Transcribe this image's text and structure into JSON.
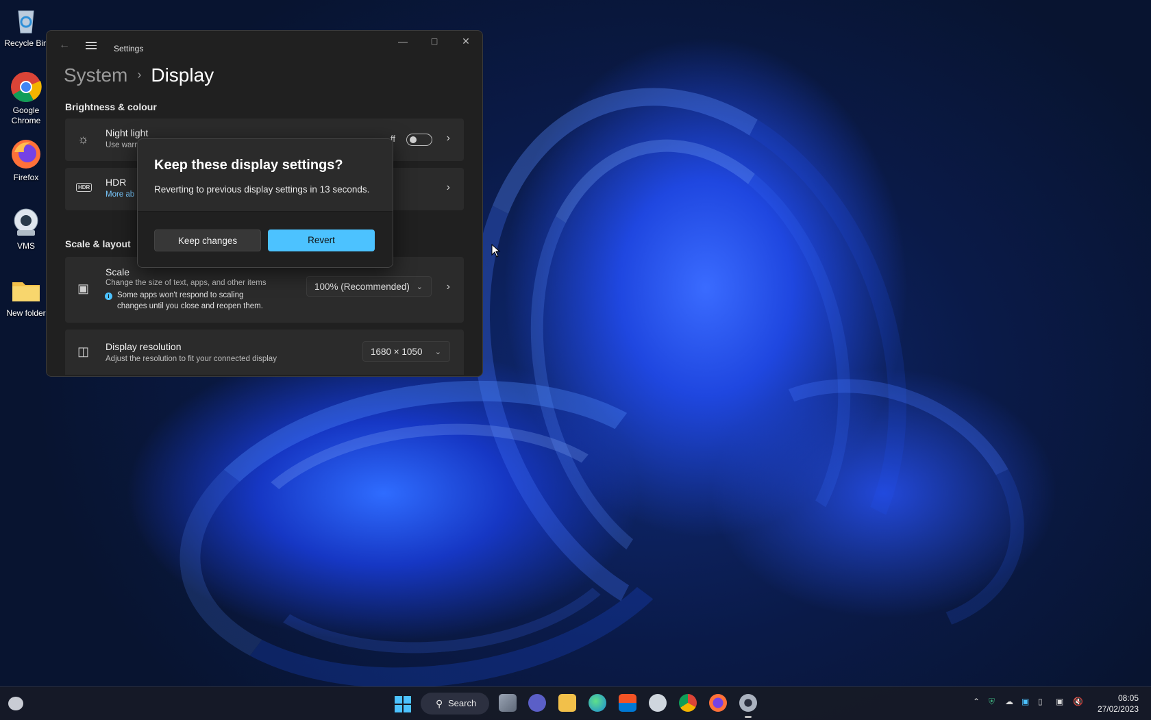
{
  "desktop": {
    "icons": [
      {
        "label": "Recycle Bin"
      },
      {
        "label": "Google Chrome"
      },
      {
        "label": "Firefox"
      },
      {
        "label": "VMS"
      },
      {
        "label": "New folder"
      }
    ]
  },
  "settings": {
    "title": "Settings",
    "breadcrumb": {
      "parent": "System",
      "separator": "›",
      "current": "Display"
    },
    "brightness_section": "Brightness & colour",
    "night_light": {
      "label": "Night light",
      "desc": "Use warm",
      "state": "ff"
    },
    "hdr": {
      "label": "HDR",
      "link": "More ab"
    },
    "scale_section": "Scale & layout",
    "scale": {
      "label": "Scale",
      "desc": "Change the size of text, apps, and other items",
      "note_line1": "Some apps won't respond to scaling",
      "note_line2": "changes until you close and reopen them.",
      "value": "100% (Recommended)"
    },
    "resolution": {
      "label": "Display resolution",
      "desc": "Adjust the resolution to fit your connected display",
      "value": "1680 × 1050"
    }
  },
  "dialog": {
    "title": "Keep these display settings?",
    "message": "Reverting to previous display settings in 13 seconds.",
    "keep_label": "Keep changes",
    "revert_label": "Revert",
    "accent": "#4cc2ff"
  },
  "taskbar": {
    "search_label": "Search",
    "time": "08:05",
    "date": "27/02/2023"
  }
}
